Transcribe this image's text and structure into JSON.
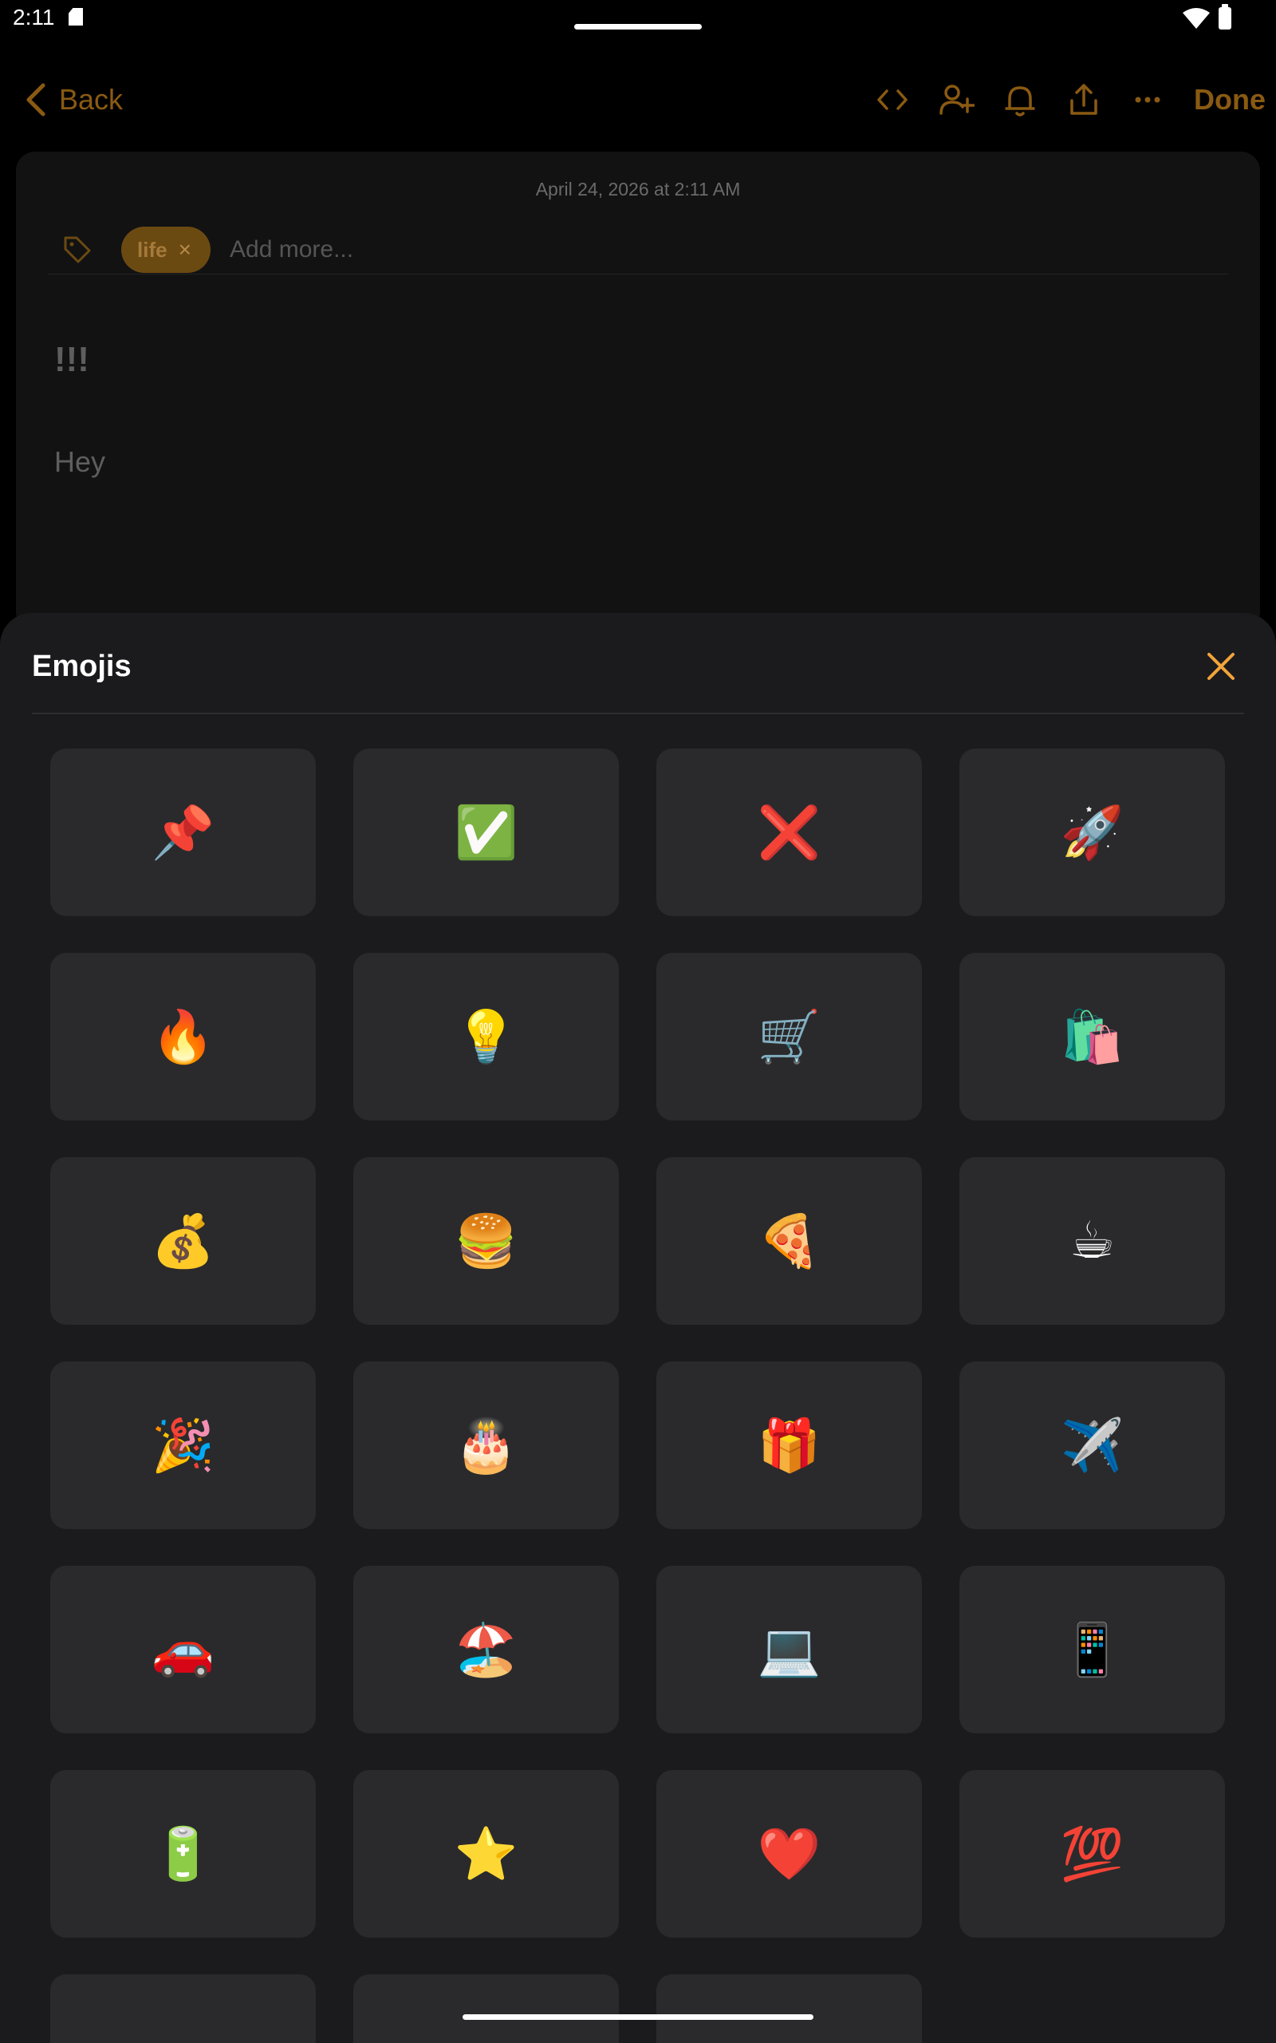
{
  "status_bar": {
    "time": "2:11",
    "icons": [
      "sd-card-icon",
      "wifi-icon",
      "battery-icon"
    ]
  },
  "toolbar": {
    "back_label": "Back",
    "done_label": "Done",
    "icons": [
      "code-icon",
      "add-person-icon",
      "bell-icon",
      "share-icon",
      "more-icon"
    ],
    "accent_color": "#8a5a12"
  },
  "note": {
    "date": "April 24, 2026 at 2:11 AM",
    "tag": "life",
    "tag_remove": "×",
    "tag_placeholder": "Add more...",
    "priority": "!!!",
    "body": "Hey"
  },
  "emoji_sheet": {
    "title": "Emojis",
    "close_color": "#f2a33a",
    "emojis": [
      "📌",
      "✅",
      "❌",
      "🚀",
      "🔥",
      "💡",
      "🛒",
      "🛍️",
      "💰",
      "🍔",
      "🍕",
      "☕",
      "🎉",
      "🎂",
      "🎁",
      "✈️",
      "🚗",
      "🏖️",
      "💻",
      "📱",
      "🔋",
      "⭐",
      "❤️",
      "💯",
      "",
      "",
      ""
    ]
  }
}
